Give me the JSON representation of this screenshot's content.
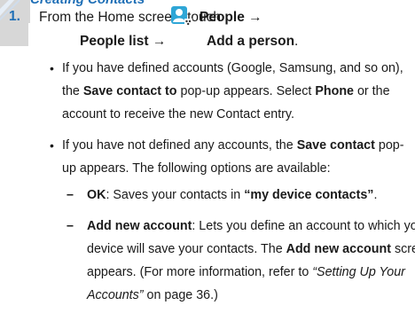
{
  "heading_cut": "Creating Contacts",
  "step": {
    "number": "1.",
    "line1_prefix": "From the Home screen, touch",
    "people_label": "People",
    "arrow": "→",
    "people_list_label": "People list",
    "add_person_label": "Add a person",
    "period": "."
  },
  "bullet1": {
    "line1": "If you have defined accounts (Google, Samsung, and so on),",
    "line2_pre": "the ",
    "save_contact_to": "Save contact to",
    "line2_mid": " pop-up appears. Select ",
    "phone": "Phone",
    "line2_post": " or the",
    "line3": "account to receive the new Contact entry."
  },
  "bullet2": {
    "line1_pre": "If you have not defined any accounts, the ",
    "save_contact": "Save contact",
    "line1_post": " pop-",
    "line2": "up appears. The following options are available:"
  },
  "option_ok": {
    "label": "OK",
    "text": ": Saves your contacts in ",
    "highlight": "“my device contacts”",
    "end": "."
  },
  "option_add": {
    "label": "Add new account",
    "line1_rest": ": Lets you define an account to which your",
    "line2_pre": "device will save your contacts. The ",
    "label_repeat": "Add new account",
    "line2_post": " screen",
    "line3_pre": "appears. (For more information, refer to ",
    "ref_title_part1": "“Setting Up Your",
    "ref_title_part2": "Accounts”",
    "line4_post": " on page 36.)"
  },
  "bullet_char": "•",
  "dash_char": "–",
  "colors": {
    "accent": "#1f6fb6",
    "icon_gray": "#d7d7d7",
    "text": "#1a1a1a"
  }
}
